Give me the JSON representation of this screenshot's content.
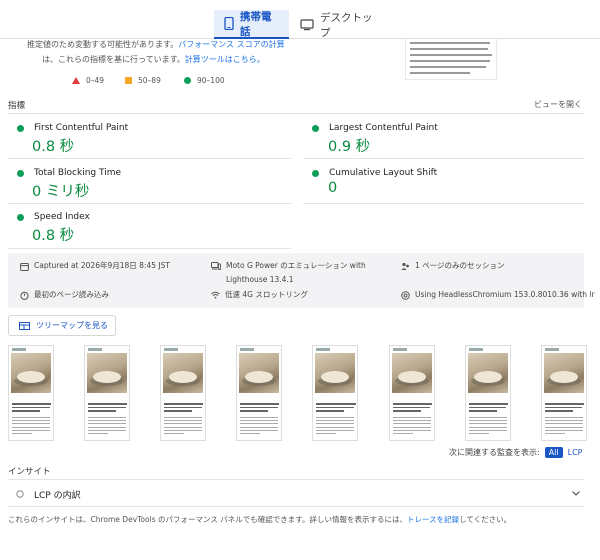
{
  "tabs": [
    {
      "label": "携帯電話",
      "icon": "mobile-phone-icon",
      "active": true
    },
    {
      "label": "デスクトップ",
      "icon": "desktop-monitor-icon",
      "active": false
    }
  ],
  "note": {
    "line1_pre": "推定値のため変動する可能性があります。",
    "line1_link": "パフォーマンス スコアの計算",
    "line2_pre": "は、これらの指標を基に行っています。",
    "line2_link": "計算ツールはこちら。"
  },
  "legend": [
    {
      "shape": "triangle",
      "color": "#e33b3b",
      "label": "0–49"
    },
    {
      "shape": "square",
      "color": "#f4a622",
      "label": "50–89"
    },
    {
      "shape": "circle",
      "color": "#0c9d58",
      "label": "90–100"
    }
  ],
  "metrics_section": {
    "title": "指標",
    "view_toggle": "ビューを開く"
  },
  "metrics": [
    {
      "name": "First Contentful Paint",
      "value": "0.8 秒",
      "status_color": "#0c9d58"
    },
    {
      "name": "Largest Contentful Paint",
      "value": "0.9 秒",
      "status_color": "#0c9d58"
    },
    {
      "name": "Total Blocking Time",
      "value": "0 ミリ秒",
      "status_color": "#0c9d58"
    },
    {
      "name": "Cumulative Layout Shift",
      "value": "0",
      "status_color": "#0c9d58"
    },
    {
      "name": "Speed Index",
      "value": "0.8 秒",
      "status_color": "#0c9d58"
    }
  ],
  "info": {
    "captured": "Captured at 2026年9月18日 8:45 JST",
    "device_line1": "Moto G Power のエミュレーション with",
    "device_line2": "Lighthouse 13.4.1",
    "session": "1 ページのみのセッション",
    "page_load": "最初のページ読み込み",
    "throttling": "低速 4G スロットリング",
    "browser": "Using HeadlessChromium 153.0.8010.36 with lr"
  },
  "treemap": {
    "label": "ツリーマップを見る"
  },
  "filmstrip": {
    "frame_count": 8
  },
  "related": {
    "label": "次に関連する監査を表示:",
    "all": "All",
    "lcp": "LCP"
  },
  "insights": {
    "title": "インサイト",
    "lcp_breakdown": "LCP の内訳",
    "footer_pre": "これらのインサイトは、Chrome DevTools のパフォーマンス パネルでも確認できます。詳しい情報を表示するには、",
    "footer_link": "トレースを記録",
    "footer_post": "してください。"
  }
}
